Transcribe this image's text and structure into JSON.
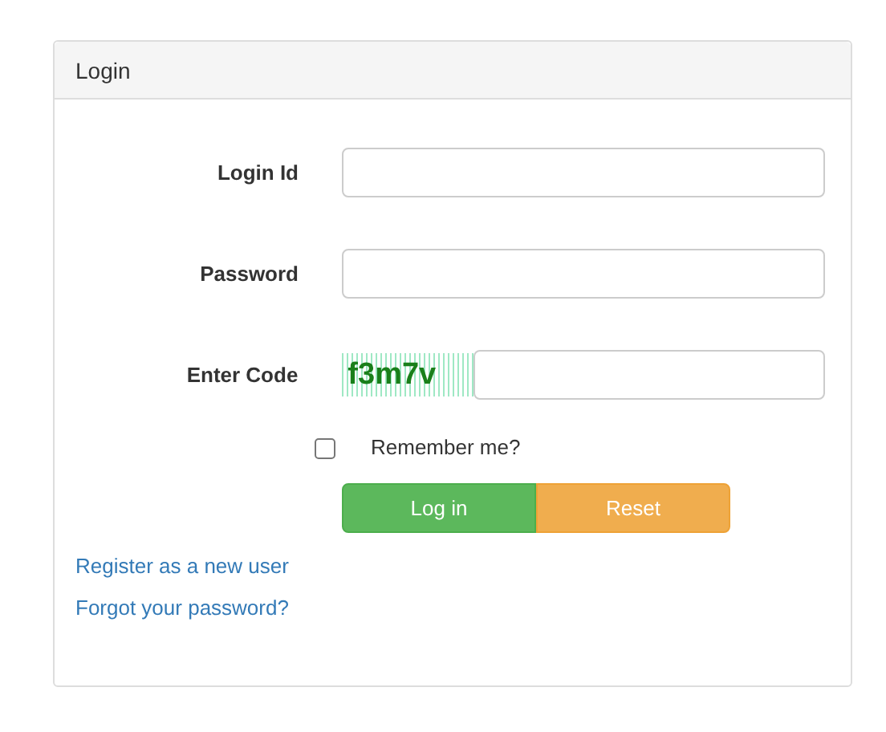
{
  "panel": {
    "title": "Login"
  },
  "fields": [
    {
      "kind": "text",
      "label": "Login Id"
    },
    {
      "kind": "password",
      "label": "Password"
    },
    {
      "kind": "captcha",
      "label": "Enter Code",
      "code": "f3m7v"
    }
  ],
  "remember": {
    "label": "Remember me?",
    "checked": false
  },
  "buttons": [
    {
      "kind": "primary",
      "label": "Log in"
    },
    {
      "kind": "warning",
      "label": "Reset"
    }
  ],
  "links": [
    "Register as a new user",
    "Forgot your password?"
  ]
}
